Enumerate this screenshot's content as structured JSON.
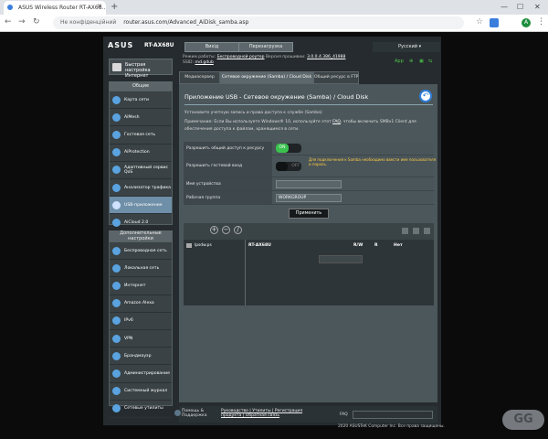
{
  "browser": {
    "tab_title": "ASUS Wireless Router RT-AX68...",
    "url_prefix": "Не конфіденційний",
    "url": "router.asus.com/Advanced_AiDisk_samba.asp",
    "avatar": "A"
  },
  "router": {
    "logo": "ASUS",
    "model": "RT-AX68U",
    "logout": "Вихід",
    "reboot": "Перезагрузка",
    "language": "Русский",
    "mode_label": "Режим работы:",
    "mode_value": "Беспроводной роутер",
    "fw_label": "Версия прошивки:",
    "fw_value": "3.0.0.4.386_41988",
    "ssid_label": "SSID:",
    "ssid_value": "rnd.gdub",
    "status_app": "App"
  },
  "sidebar": {
    "qis": "Быстрая настройка Интернет",
    "general_header": "Общие",
    "general": [
      "Карта сети",
      "AiMesh",
      "Гостевая сеть",
      "AiProtection",
      "Адаптивный сервис QoS",
      "Анализатор трафика",
      "USB-приложение",
      "AiCloud 2.0"
    ],
    "advanced_header": "Дополнительные настройки",
    "advanced": [
      "Беспроводная сеть",
      "Локальная сеть",
      "Интернет",
      "Amazon Alexa",
      "IPv6",
      "VPN",
      "Брандмауэр",
      "Администрирование",
      "Системный журнал",
      "Сетевые утилиты"
    ]
  },
  "tabs": [
    "Медиасервер",
    "Сетевое окружение (Samba) / Cloud Disk",
    "Общий ресурс в FTP"
  ],
  "content": {
    "title": "Приложение USB - Сетевое окружение (Samba) / Cloud Disk",
    "desc1": "Установите учетную запись и права доступа к службе (Samba)",
    "desc2_a": "Примечание: Если Вы используете Windows® 10, используйте этот ",
    "desc2_link": "FAQ",
    "desc2_b": ", чтобы включить SMBv1 Client для обеспечения доступа к файлам, хранящимся в сети."
  },
  "form": {
    "share_label": "Разрешить общий доступ к ресурсу",
    "share_state": "ON",
    "guest_label": "Разрешить гостевой вход",
    "guest_state": "OFF",
    "guest_warning": "Для подключения к Samba необходимо ввести имя пользователя и пароль.",
    "device_label": "Имя устройства",
    "device_value": "",
    "workgroup_label": "Рабочая группа",
    "workgroup_value": "WORKGROUP",
    "apply": "Применить"
  },
  "table": {
    "device": "lpsdw.ps",
    "col_name": "RT-AX68U",
    "col_rw": "R/W",
    "col_r": "R",
    "col_none": "Нет"
  },
  "footer": {
    "help": "Помощь &",
    "help2": "Поддержка",
    "links1": "Руководство | Утилиты | Регистрация",
    "links2": "продукта | Обратная связь",
    "faq": "FAQ",
    "copyright": "2020 ASUSTeK Computer Inc. Все права защищены."
  },
  "watermark": "GG"
}
